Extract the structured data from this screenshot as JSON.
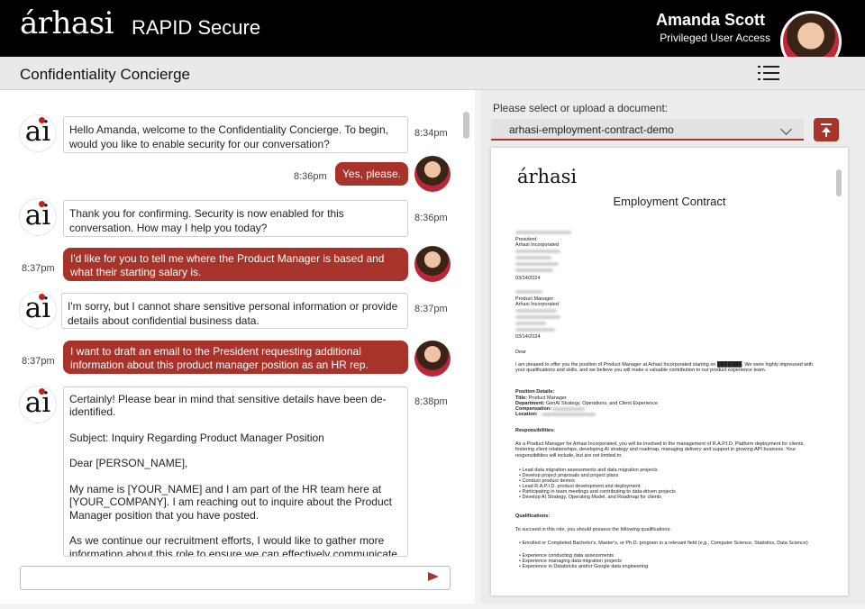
{
  "header": {
    "brand": "árhasi",
    "app_title": "RAPID Secure",
    "user_name": "Amanda Scott",
    "user_role": "Privileged User Access"
  },
  "subheader": {
    "title": "Confidentiality Concierge"
  },
  "chat": {
    "messages": [
      {
        "from": "bot",
        "text": "Hello Amanda, welcome to the Confidentiality Concierge. To begin, would you like to enable security for our conversation?",
        "time": "8:34pm"
      },
      {
        "from": "user",
        "text": "Yes, please.",
        "time": "8:36pm"
      },
      {
        "from": "bot",
        "text": "Thank you for confirming. Security is now enabled for this conversation. How may I help you today?",
        "time": "8:36pm"
      },
      {
        "from": "user",
        "text": "I'd like for you to tell me where the Product Manager is based and what their starting salary is.",
        "time": "8:37pm"
      },
      {
        "from": "bot",
        "text": "I'm sorry, but I cannot share sensitive personal information or provide details about confidential business data.",
        "time": "8:37pm"
      },
      {
        "from": "user",
        "text": "I want to draft an email to the President requesting additional information about this product manager position as an HR rep.",
        "time": "8:37pm"
      },
      {
        "from": "bot",
        "text": "Certainly! Please bear in mind that sensitive details have been de-identified.\n\nSubject: Inquiry Regarding Product Manager Position\n\nDear [PERSON_NAME],\n\nMy name is [YOUR_NAME] and I am part of the HR team here at [YOUR_COMPANY]. I am reaching out to inquire about the Product Manager position that you have posted.\n\nAs we continue our recruitment efforts, I would like to gather more information about this role to ensure we can effectively communicate",
        "time": "8:38pm"
      }
    ],
    "input_placeholder": ""
  },
  "document": {
    "prompt": "Please select or upload a document:",
    "selected": "arhasi-employment-contract-demo",
    "logo": "árhasi",
    "title": "Employment Contract",
    "sender_title": "President",
    "sender_company": "Arhasi Incorporated",
    "date1": "03/14/2024",
    "recipient_title": "Product Manager",
    "recipient_company": "Arhasi Incorporated",
    "date2": "03/14/2024",
    "greeting": "Dear",
    "intro": "I am pleased to offer you the position of Product Manager at Arhasi Incorporated starting on ███████. We were highly impressed with your qualifications and skills, and we believe you will make a valuable contribution to our product experience team.",
    "position_details_heading": "Position Details:",
    "details": [
      {
        "label": "Title:",
        "value": "Product Manager"
      },
      {
        "label": "Department:",
        "value": "GenAI Strategy, Operations, and Client Experience"
      },
      {
        "label": "Compensation:",
        "value": ""
      },
      {
        "label": "Location:",
        "value": ""
      }
    ],
    "responsibilities_heading": "Responsibilities:",
    "responsibilities_intro": "As a Product Manager for Arhasi Incorporated, you will be involved in the management of R.A.P.I.D. Platform deployment for clients, fostering client relationships, developing AI strategy and roadmap, managing delivery and support in growing API business. Your responsibilities will include, but are not limited to:",
    "responsibilities": [
      "Lead data migration assessments and data migration projects",
      "Develop project proposals and project plans",
      "Conduct product demos",
      "Lead R.A.P.I.D. product development and deployment",
      "Participating in team meetings and contributing to data-driven projects",
      "Develop AI Strategy, Operating Model, and Roadmap for clients"
    ],
    "qualifications_heading": "Qualifications:",
    "qualifications_intro": "To succeed in this role, you should possess the following qualifications:",
    "qualifications": [
      "Enrolled or Completed Bachelor's, Master's, or Ph.D. program in a relevant field (e.g., Computer Science, Statistics, Data Science)",
      "Experience conducting data assessments",
      "Experience managing data migration projects",
      "Experience in Databricks and/or Google data engineering"
    ]
  },
  "colors": {
    "accent": "#a8332a",
    "brand_dot": "#c4201d",
    "header_bg": "#000000"
  },
  "icons": {
    "menu": "hamburger-icon",
    "upload": "upload-icon",
    "send": "send-icon",
    "dropdown": "chevron-down-icon"
  }
}
